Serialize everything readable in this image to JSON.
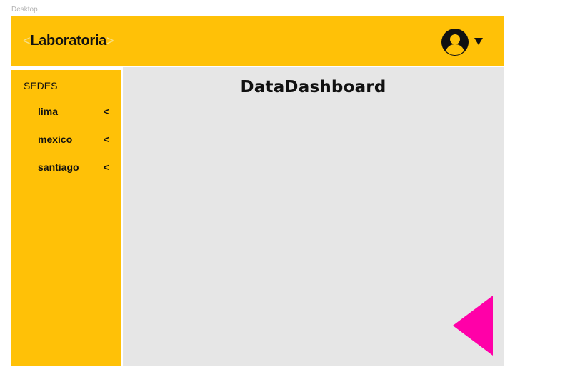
{
  "artboard": {
    "label": "Desktop"
  },
  "header": {
    "logo_text": "Laboratoria",
    "logo_bracket_left": "<",
    "logo_bracket_right": ">",
    "user_icon": "user-avatar-icon",
    "menu_icon": "caret-down-icon"
  },
  "sidebar": {
    "title": "SEDES",
    "items": [
      {
        "label": "lima",
        "chevron": "<"
      },
      {
        "label": "mexico",
        "chevron": "<"
      },
      {
        "label": "santiago",
        "chevron": "<"
      }
    ]
  },
  "main": {
    "title": "DataDashboard",
    "back_icon": "triangle-left-icon"
  },
  "colors": {
    "brand_yellow": "#ffc107",
    "content_gray": "#e6e6e6",
    "accent_magenta": "#ff00a8",
    "text_dark": "#111111"
  }
}
